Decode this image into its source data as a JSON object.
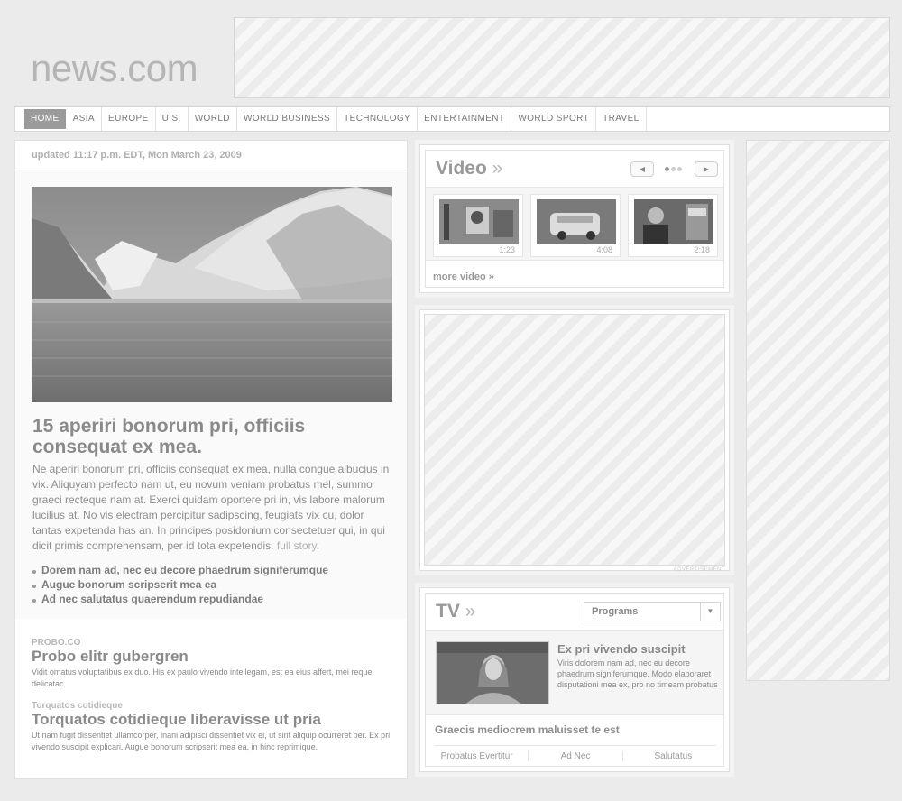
{
  "logo": "news.com",
  "nav": [
    "HOME",
    "ASIA",
    "EUROPE",
    "U.S.",
    "WORLD",
    "WORLD BUSINESS",
    "TECHNOLOGY",
    "ENTERTAINMENT",
    "WORLD SPORT",
    "TRAVEL"
  ],
  "main": {
    "updated": "updated 11:17 p.m. EDT, Mon March 23, 2009",
    "headline": "15 aperiri bonorum pri, officiis consequat ex mea.",
    "body": "Ne aperiri bonorum pri, officiis consequat ex mea, nulla congue albucius in vix. Aliquyam perfecto nam ut, eu novum veniam probatus mel, summo graeci recteque nam at. Exerci quidam oportere pri in, vis labore malorum lucilius at. No vis electram percipitur sadipscing, feugiats vix cu, dolor tantas expetenda has an. In principes posidonium consectetuer qui, in qui dicit primis comprehensam, per id tota expetendis.",
    "full_story": "full story.",
    "bullets": [
      "Dorem nam ad, nec eu decore phaedrum signiferumque",
      "Augue bonorum scripserit mea ea",
      "Ad nec salutatus quaerendum repudiandae"
    ]
  },
  "stories": [
    {
      "kicker": "PROBO.CO",
      "title": "Probo elitr gubergren",
      "desc": "Vidit omatus voluptatibus ex duo. His ex paulo vivendo intellegam, est ea eius affert, mei reque delicatac"
    },
    {
      "kicker": "Torquatos cotidieque",
      "title": "Torquatos cotidieque liberavisse ut pria",
      "desc": "Ut nam fugit dissentiet ullamcorper, inani adipisci dissentiet vix ei, ut sint aliquip ocurreret per. Ex pri vivendo suscipit explicari. Augue bonorum scripserit mea ea, in hinc reprimique."
    }
  ],
  "video": {
    "title": "Video",
    "arrow": "»",
    "durations": [
      "1:23",
      "4:08",
      "2:18"
    ],
    "more": "more video »"
  },
  "ad_label": "ADVERTISEMENT",
  "tv": {
    "title": "TV",
    "arrow": "»",
    "select": "Programs",
    "feature_title": "Ex pri vivendo suscipit",
    "feature_desc": "Viris dolorem nam ad, nec eu decore phaedrum signiferumque. Modo elaboraret disputationi mea ex, pro no timeam probatus",
    "link": "Graecis mediocrem maluisset te est",
    "tabs": [
      "Probatus Evertitur",
      "Ad Nec",
      "Salutatus"
    ]
  }
}
